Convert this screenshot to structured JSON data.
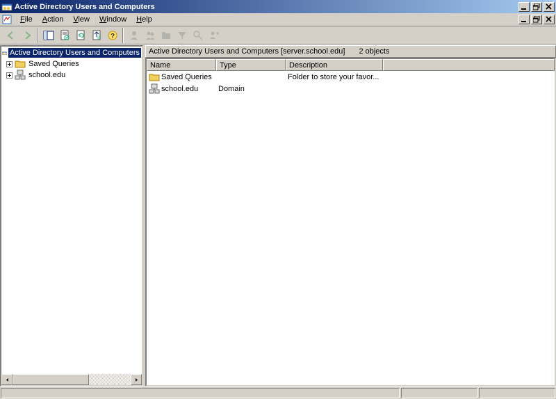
{
  "title": "Active Directory Users and Computers",
  "menu": {
    "file": "File",
    "action": "Action",
    "view": "View",
    "window": "Window",
    "help": "Help"
  },
  "tree": {
    "root": "Active Directory Users and Computers",
    "node1": "Saved Queries",
    "node2": "school.edu"
  },
  "descbar": {
    "path": "Active Directory Users and Computers [server.school.edu]",
    "count": "2 objects"
  },
  "columns": {
    "name": "Name",
    "type": "Type",
    "desc": "Description"
  },
  "rows": [
    {
      "name": "Saved Queries",
      "type": "",
      "desc": "Folder to store your favor...",
      "icon": "folder"
    },
    {
      "name": "school.edu",
      "type": "Domain",
      "desc": "",
      "icon": "domain"
    }
  ]
}
